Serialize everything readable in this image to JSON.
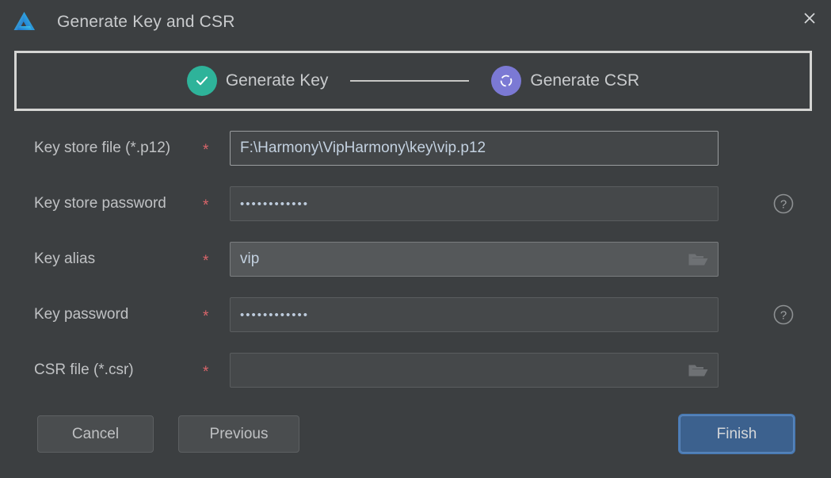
{
  "window": {
    "title": "Generate Key and CSR",
    "logo_icon": "deveco-studio-logo-icon",
    "close_icon": "close-icon",
    "background_color": "#3c3f41"
  },
  "stepper": {
    "steps": [
      {
        "label": "Generate Key",
        "state": "done",
        "icon": "check-circle-icon",
        "color": "#2eb39a"
      },
      {
        "label": "Generate CSR",
        "state": "current",
        "icon": "spinner-circle-icon",
        "color": "#7b79d4"
      }
    ]
  },
  "form": {
    "required_marker": "*",
    "fields": [
      {
        "label": "Key store file (*.p12)",
        "required": true,
        "value": "F:\\Harmony\\VipHarmony\\key\\vip.p12",
        "placeholder": "",
        "type": "text",
        "state": "focused",
        "has_folder_icon": false,
        "has_help_icon": false
      },
      {
        "label": "Key store password",
        "required": true,
        "value": "••••••••••••",
        "placeholder": "",
        "type": "password",
        "state": "normal",
        "has_folder_icon": false,
        "has_help_icon": true
      },
      {
        "label": "Key alias",
        "required": true,
        "value": "vip",
        "placeholder": "",
        "type": "text",
        "state": "hovered",
        "has_folder_icon": true,
        "has_help_icon": false
      },
      {
        "label": "Key password",
        "required": true,
        "value": "••••••••••••",
        "placeholder": "",
        "type": "password",
        "state": "normal",
        "has_folder_icon": false,
        "has_help_icon": true
      },
      {
        "label": "CSR file (*.csr)",
        "required": true,
        "value": "",
        "placeholder": "",
        "type": "text",
        "state": "normal",
        "has_folder_icon": true,
        "has_help_icon": false
      }
    ]
  },
  "buttons": {
    "cancel": "Cancel",
    "previous": "Previous",
    "finish": "Finish",
    "finish_accent_color": "#3c618e"
  },
  "icons": {
    "folder": "folder-open-icon",
    "help": "help-circle-icon"
  }
}
